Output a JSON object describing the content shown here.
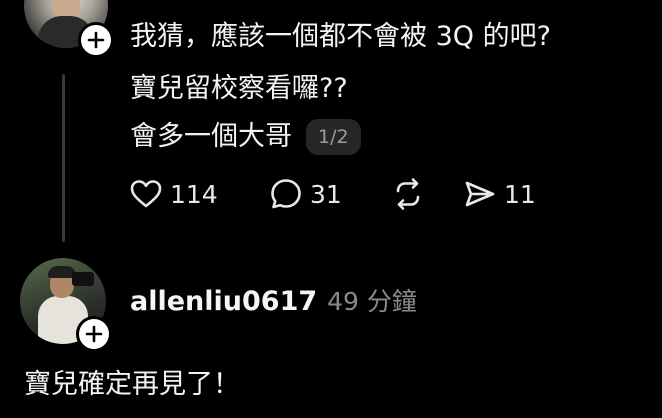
{
  "post1": {
    "lines": [
      "我猜，應該一個都不會被 3Q 的吧?",
      "寶兒留校察看囉??",
      "會多一個大哥"
    ],
    "page_indicator": "1/2",
    "like_count": "114",
    "reply_count": "31",
    "share_count": "11"
  },
  "post2": {
    "username": "allenliu0617",
    "timestamp": "49 分鐘",
    "text": "寶兒確定再見了！"
  }
}
